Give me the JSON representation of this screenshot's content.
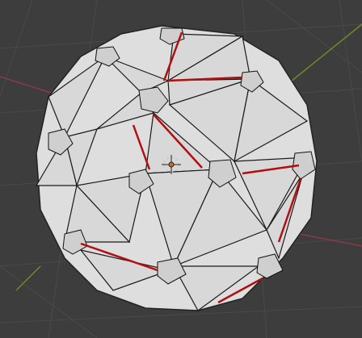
{
  "viewport": {
    "background": "#3d3d3d",
    "grid_color": "#4a4a4a",
    "x_axis_color": "#8a3a48",
    "y_axis_color": "#6b8a2a",
    "mesh_fill": "#dedede",
    "mesh_shade": "#c9c9c9",
    "wire_color": "#1a1a1a",
    "seam_color": "#b01010",
    "origin_color": "#d06a20"
  },
  "scene": {
    "object": "icosphere-bevelled",
    "icons": [
      "3d-cursor-icon",
      "object-origin-icon"
    ]
  }
}
